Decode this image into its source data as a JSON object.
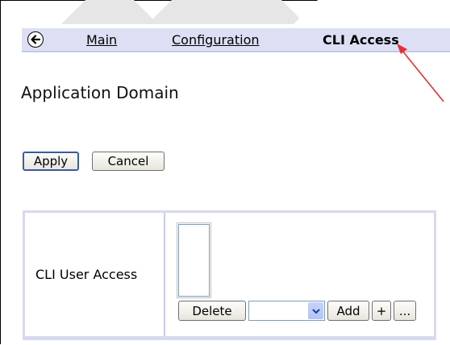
{
  "tabs": [
    {
      "label": "Main",
      "active": false
    },
    {
      "label": "Configuration",
      "active": false
    },
    {
      "label": "CLI Access",
      "active": true
    }
  ],
  "icons": {
    "back": "back-arrow-icon",
    "annotation": "red-arrow-annotation",
    "dropdown": "chevron-down-icon"
  },
  "page": {
    "title": "Application Domain"
  },
  "actions": {
    "apply_label": "Apply",
    "cancel_label": "Cancel"
  },
  "form": {
    "field_label": "CLI User Access",
    "delete_label": "Delete",
    "select_value": "",
    "add_label": "Add",
    "plus_label": "+",
    "browse_label": "..."
  },
  "colors": {
    "tabbar": "#dde0f4",
    "annotation": "#e53030",
    "form_border": "#d6d9ef"
  }
}
